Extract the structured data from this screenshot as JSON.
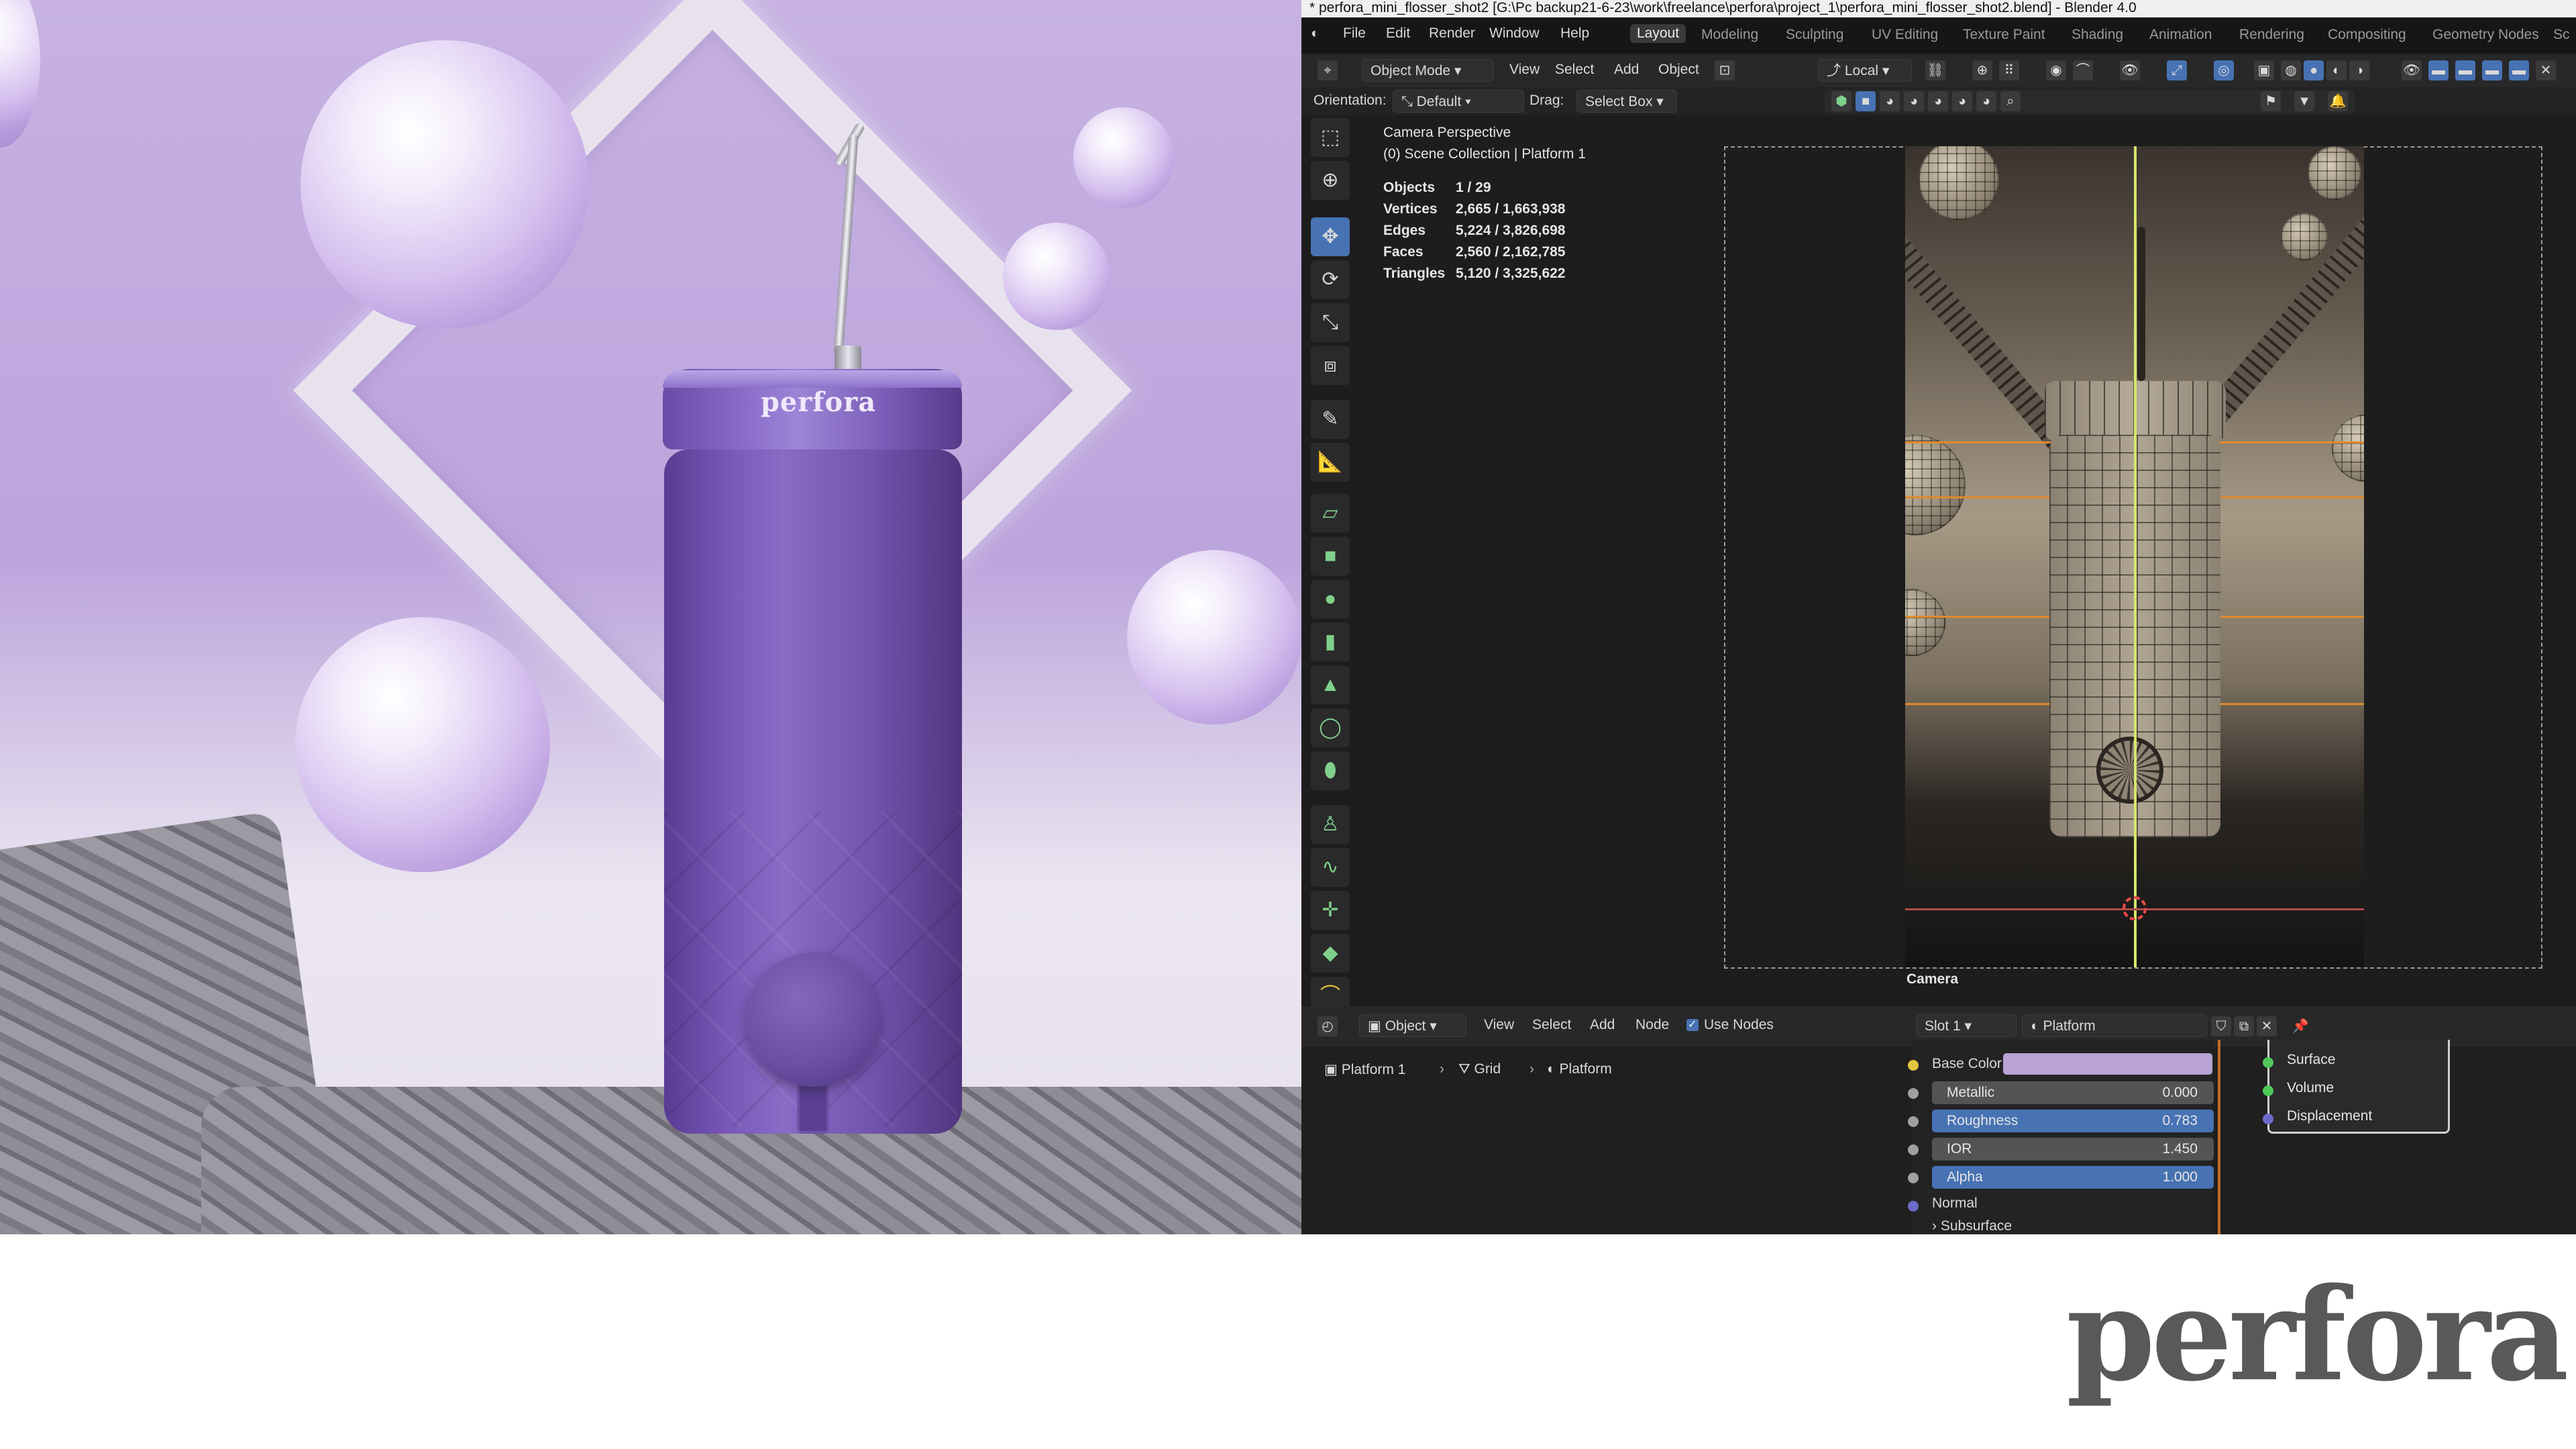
{
  "render": {
    "brand_on_cap": "perfora"
  },
  "blender": {
    "title": "* perfora_mini_flosser_shot2 [G:\\Pc backup21-6-23\\work\\freelance\\perfora\\project_1\\perfora_mini_flosser_shot2.blend] - Blender 4.0",
    "menu": [
      "File",
      "Edit",
      "Render",
      "Window",
      "Help"
    ],
    "workspaces": [
      "Layout",
      "Modeling",
      "Sculpting",
      "UV Editing",
      "Texture Paint",
      "Shading",
      "Animation",
      "Rendering",
      "Compositing",
      "Geometry Nodes",
      "Sc"
    ],
    "active_workspace": "Layout",
    "header": {
      "mode": "Object Mode",
      "menus": [
        "View",
        "Select",
        "Add",
        "Object"
      ],
      "transform_space": "Local"
    },
    "header2": {
      "orientation_label": "Orientation:",
      "orientation_value": "Default",
      "drag_label": "Drag:",
      "drag_value": "Select Box"
    },
    "viewport": {
      "view_name": "Camera Perspective",
      "collection": "(0) Scene Collection | Platform 1",
      "stats": [
        {
          "label": "Objects",
          "value": "1 / 29"
        },
        {
          "label": "Vertices",
          "value": "2,665 / 1,663,938"
        },
        {
          "label": "Edges",
          "value": "5,224 / 3,826,698"
        },
        {
          "label": "Faces",
          "value": "2,560 / 2,162,785"
        },
        {
          "label": "Triangles",
          "value": "5,120 / 3,325,622"
        }
      ],
      "camera_label": "Camera"
    },
    "node_editor": {
      "object_selector": "Object",
      "menus": [
        "View",
        "Select",
        "Add",
        "Node"
      ],
      "use_nodes_label": "Use Nodes",
      "slot": "Slot 1",
      "material_name": "Platform",
      "breadcrumb": [
        "Platform 1",
        "Grid",
        "Platform"
      ],
      "base_color_label": "Base Color",
      "base_color": "#b9a3d6",
      "fields": [
        {
          "label": "Metallic",
          "value": "0.000"
        },
        {
          "label": "Roughness",
          "value": "0.783"
        },
        {
          "label": "IOR",
          "value": "1.450"
        },
        {
          "label": "Alpha",
          "value": "1.000"
        }
      ],
      "normal_label": "Normal",
      "subsurface_label": "Subsurface",
      "output_sockets": [
        "Surface",
        "Volume",
        "Displacement"
      ]
    }
  },
  "logo_text": "perfora"
}
